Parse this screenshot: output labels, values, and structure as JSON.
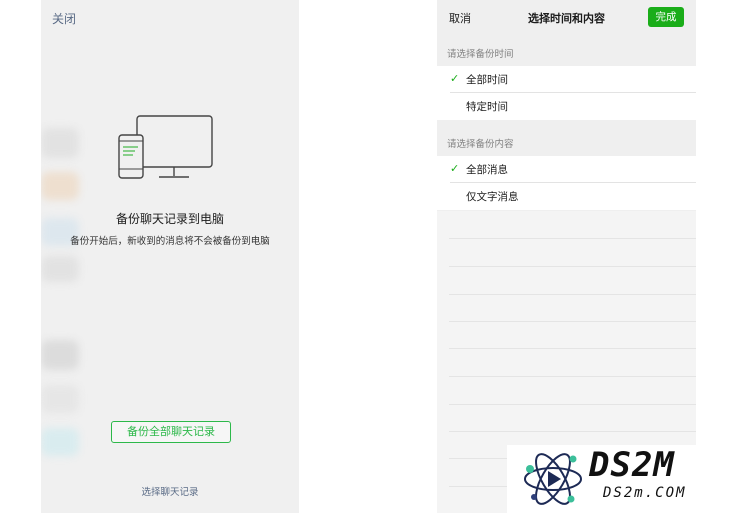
{
  "left": {
    "close": "关闭",
    "title": "备份聊天记录到电脑",
    "description": "备份开始后，新收到的消息将不会被备份到电脑",
    "backup_all": "备份全部聊天记录",
    "select": "选择聊天记录"
  },
  "right": {
    "cancel": "取消",
    "title": "选择时间和内容",
    "done": "完成",
    "time_header": "请选择备份时间",
    "time_options": [
      {
        "label": "全部时间",
        "checked": true
      },
      {
        "label": "特定时间",
        "checked": false
      }
    ],
    "content_header": "请选择备份内容",
    "content_options": [
      {
        "label": "全部消息",
        "checked": true
      },
      {
        "label": "仅文字消息",
        "checked": false
      }
    ]
  },
  "watermark": {
    "brand": "DS2M",
    "domain": "DS2m.COM"
  },
  "colors": {
    "accent_green": "#1aad19",
    "link_blue": "#5a6b86",
    "panel_gray": "#f0f0f0"
  },
  "icons": {
    "checkmark": "check-icon",
    "device": "computer-phone-icon",
    "logo": "atom-logo-icon"
  }
}
